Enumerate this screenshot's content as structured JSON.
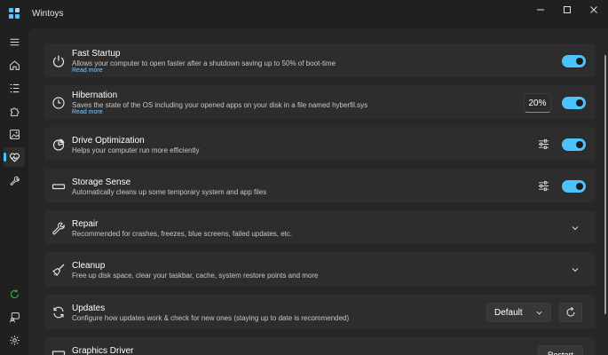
{
  "app": {
    "title": "Wintoys",
    "accent_color": "#4cc2ff",
    "icon_colors": [
      "#4cc2ff",
      "#a0d8ff",
      "#7fb8e0",
      "#4cc2ff"
    ]
  },
  "window_controls": {
    "minimize_icon": "minimize-icon",
    "maximize_icon": "maximize-icon",
    "close_icon": "close-icon"
  },
  "nav": {
    "items": [
      {
        "icon": "hamburger-menu-icon"
      },
      {
        "icon": "home-icon"
      },
      {
        "icon": "apps-list-icon"
      },
      {
        "icon": "puzzle-icon"
      },
      {
        "icon": "image-icon"
      },
      {
        "icon": "health-heart-icon",
        "active": true
      },
      {
        "icon": "wrench-icon"
      },
      {
        "icon": "refresh-circle-icon",
        "color": "#2fa84f"
      },
      {
        "icon": "feedback-icon"
      },
      {
        "icon": "settings-gear-icon"
      }
    ]
  },
  "cards": {
    "fast_startup": {
      "title": "Fast Startup",
      "description": "Allows your computer to open faster after a shutdown saving up to 50% of boot-time",
      "link": "Read more",
      "enabled": true
    },
    "hibernation": {
      "title": "Hibernation",
      "description": "Saves the state of the OS including your opened apps on your disk in a file named hyberfil.sys",
      "link": "Read more",
      "percent": "20%",
      "enabled": true
    },
    "drive_optimization": {
      "title": "Drive Optimization",
      "description": "Helps your computer run more efficiently",
      "enabled": true
    },
    "storage_sense": {
      "title": "Storage Sense",
      "description": "Automatically cleans up some temporary system and app files",
      "enabled": true
    },
    "repair": {
      "title": "Repair",
      "description": "Recommended for crashes, freezes, blue screens, failed updates, etc."
    },
    "cleanup": {
      "title": "Cleanup",
      "description": "Free up disk space, clear your taskbar, cache, system restore points and more"
    },
    "updates": {
      "title": "Updates",
      "description": "Configure how updates work & check for new ones (staying up to date is recommended)",
      "mode": "Default"
    },
    "graphics_driver": {
      "title": "Graphics Driver",
      "button": "Restart"
    }
  }
}
